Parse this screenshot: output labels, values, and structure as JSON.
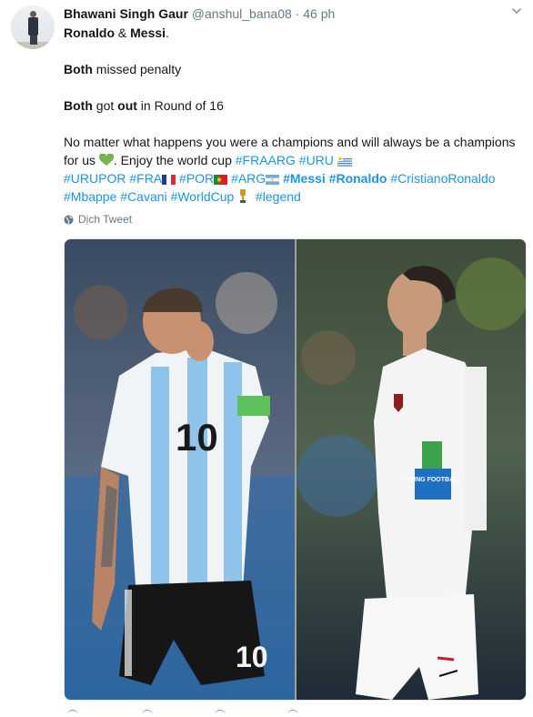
{
  "author": {
    "name": "Bhawani Singh Gaur",
    "handle": "@anshul_bana08",
    "separator": "·",
    "time": "46 ph"
  },
  "tweet": {
    "line1_a": "Ronaldo",
    "line1_b": " & ",
    "line1_c": "Messi",
    "line1_d": ".",
    "line2_a": "Both",
    "line2_b": " missed penalty",
    "line3_a": "Both",
    "line3_b": " got ",
    "line3_c": "out",
    "line3_d": " in Round of 16",
    "line4": "No matter what happens you were a champions and will always be a champions",
    "line5_a": "for us ",
    "line5_b": ". Enjoy the world cup ",
    "hashtags": {
      "fraarg": "#FRAARG",
      "uru": "#URU",
      "urupor": "#URUPOR",
      "fra": "#FRA",
      "por": "#POR",
      "arg": "#ARG",
      "messi": "#Messi",
      "ronaldo": "#Ronaldo",
      "cristianoronaldo": "#CristianoRonaldo",
      "mbappe": "#Mbappe",
      "cavani": "#Cavani",
      "worldcup": "#WorldCup",
      "legend": "#legend"
    }
  },
  "translate_label": "Dịch Tweet",
  "media": {
    "left_jersey_number": "10",
    "left_shorts_number": "10",
    "right_sleeve_patch": "LIVING FOOTBALL"
  },
  "colors": {
    "link": "#1b95e0",
    "muted": "#657786",
    "text": "#14171a"
  }
}
